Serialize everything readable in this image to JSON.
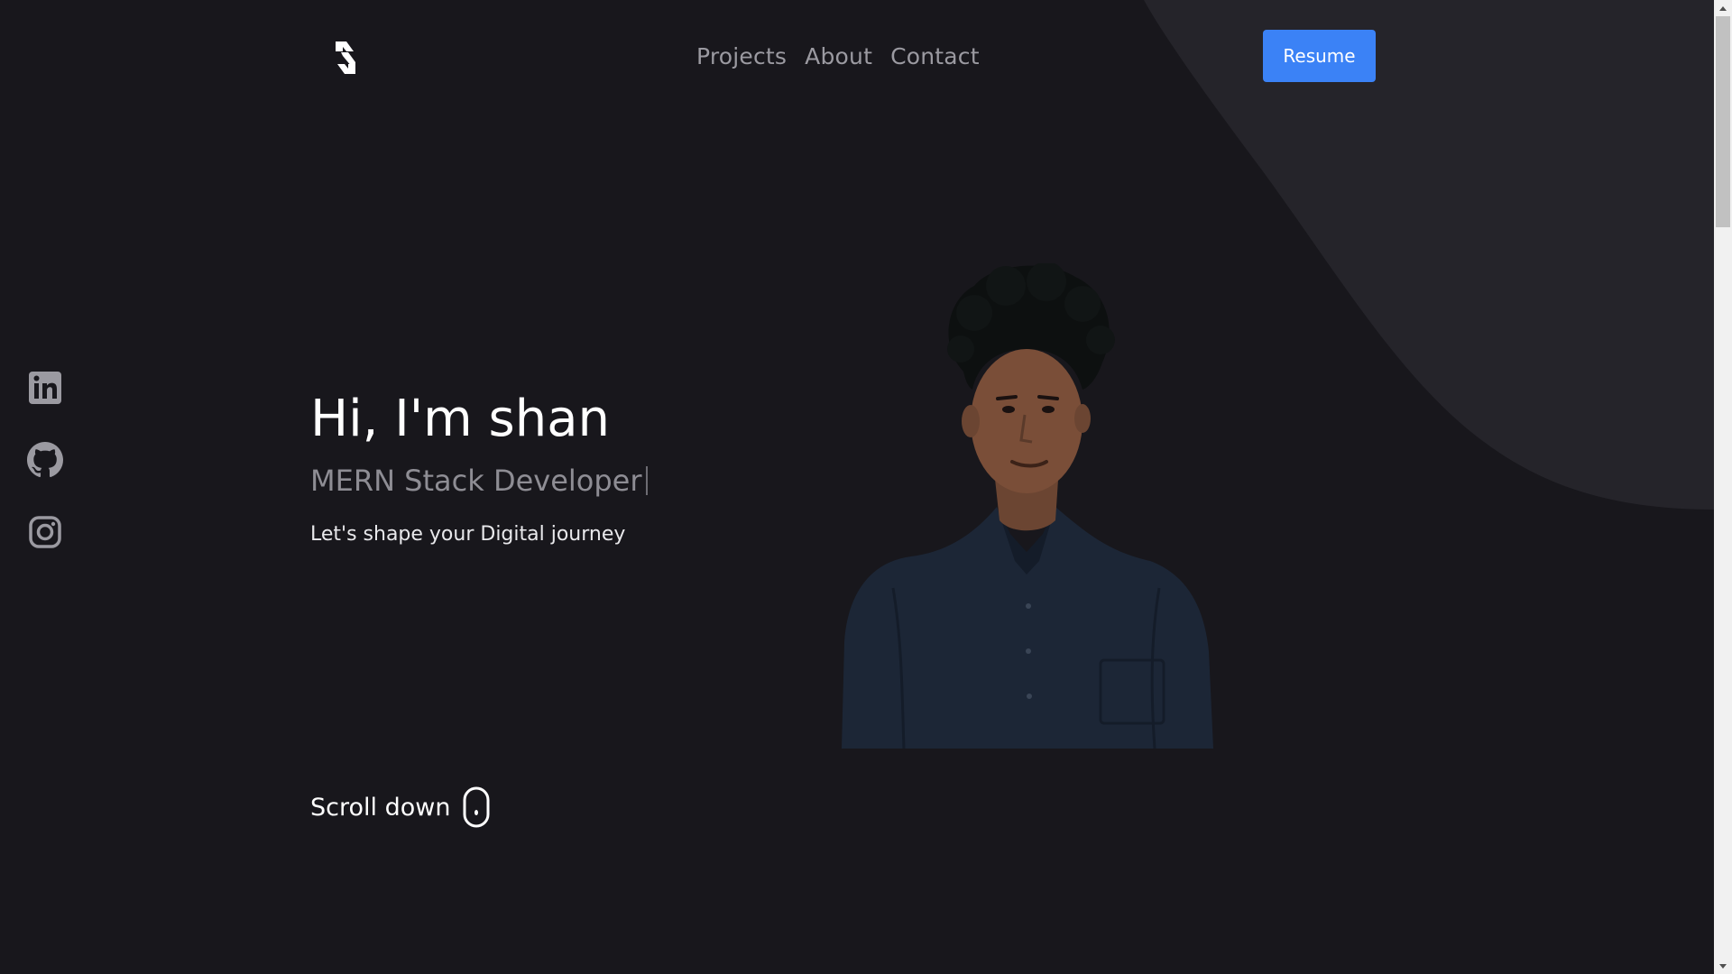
{
  "header": {
    "logo_icon": "s-monogram-logo",
    "nav": [
      {
        "label": "Projects"
      },
      {
        "label": "About"
      },
      {
        "label": "Contact"
      }
    ],
    "resume_label": "Resume"
  },
  "social": [
    {
      "icon": "linkedin-icon"
    },
    {
      "icon": "github-icon"
    },
    {
      "icon": "instagram-icon"
    }
  ],
  "hero": {
    "title": "Hi, I'm shan",
    "role": "MERN Stack Developer",
    "tagline": "Let's shape your Digital journey",
    "scroll_label": "Scroll down"
  },
  "colors": {
    "background": "#18171c",
    "curve": "#25242a",
    "accent": "#3b82f6"
  }
}
